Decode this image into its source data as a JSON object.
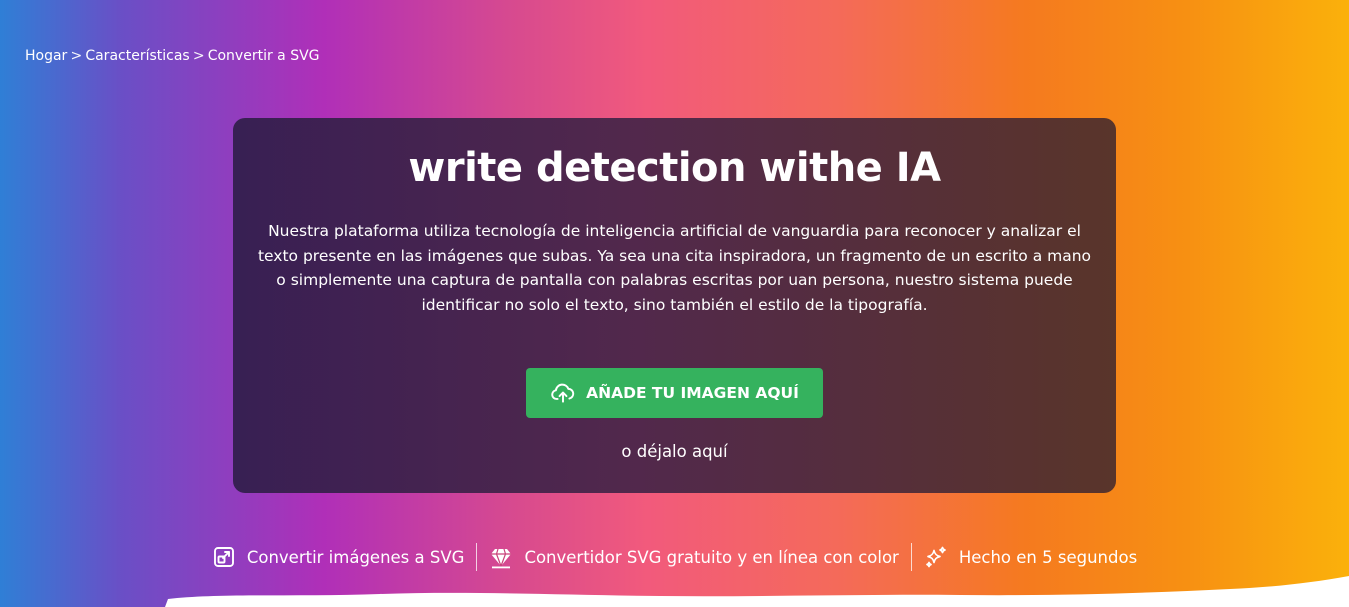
{
  "breadcrumb": {
    "items": [
      "Hogar",
      "Características",
      "Convertir a SVG"
    ],
    "separator": ">"
  },
  "card": {
    "title": "write detection withe IA",
    "description": "Nuestra plataforma utiliza tecnología de inteligencia artificial de vanguardia para reconocer y analizar el texto presente en las imágenes que subas. Ya sea una cita inspiradora, un fragmento de un escrito a mano o simplemente una captura de pantalla con palabras escritas por uan persona, nuestro sistema puede identificar no solo el texto, sino también el estilo de la tipografía.",
    "upload_label": "AÑADE TU IMAGEN AQUÍ",
    "drop_label": "o déjalo aquí"
  },
  "features": [
    {
      "icon": "external-link-icon",
      "label": "Convertir imágenes a SVG"
    },
    {
      "icon": "diamond-icon",
      "label": "Convertidor SVG gratuito y en línea con color"
    },
    {
      "icon": "sparkles-icon",
      "label": "Hecho en 5 segundos"
    }
  ],
  "colors": {
    "upload_button": "#35b25e",
    "card_background": "#3d2752",
    "gradient_left": "#2f7fd6",
    "gradient_mid": "#f25a7c",
    "gradient_right": "#fbb10b"
  }
}
